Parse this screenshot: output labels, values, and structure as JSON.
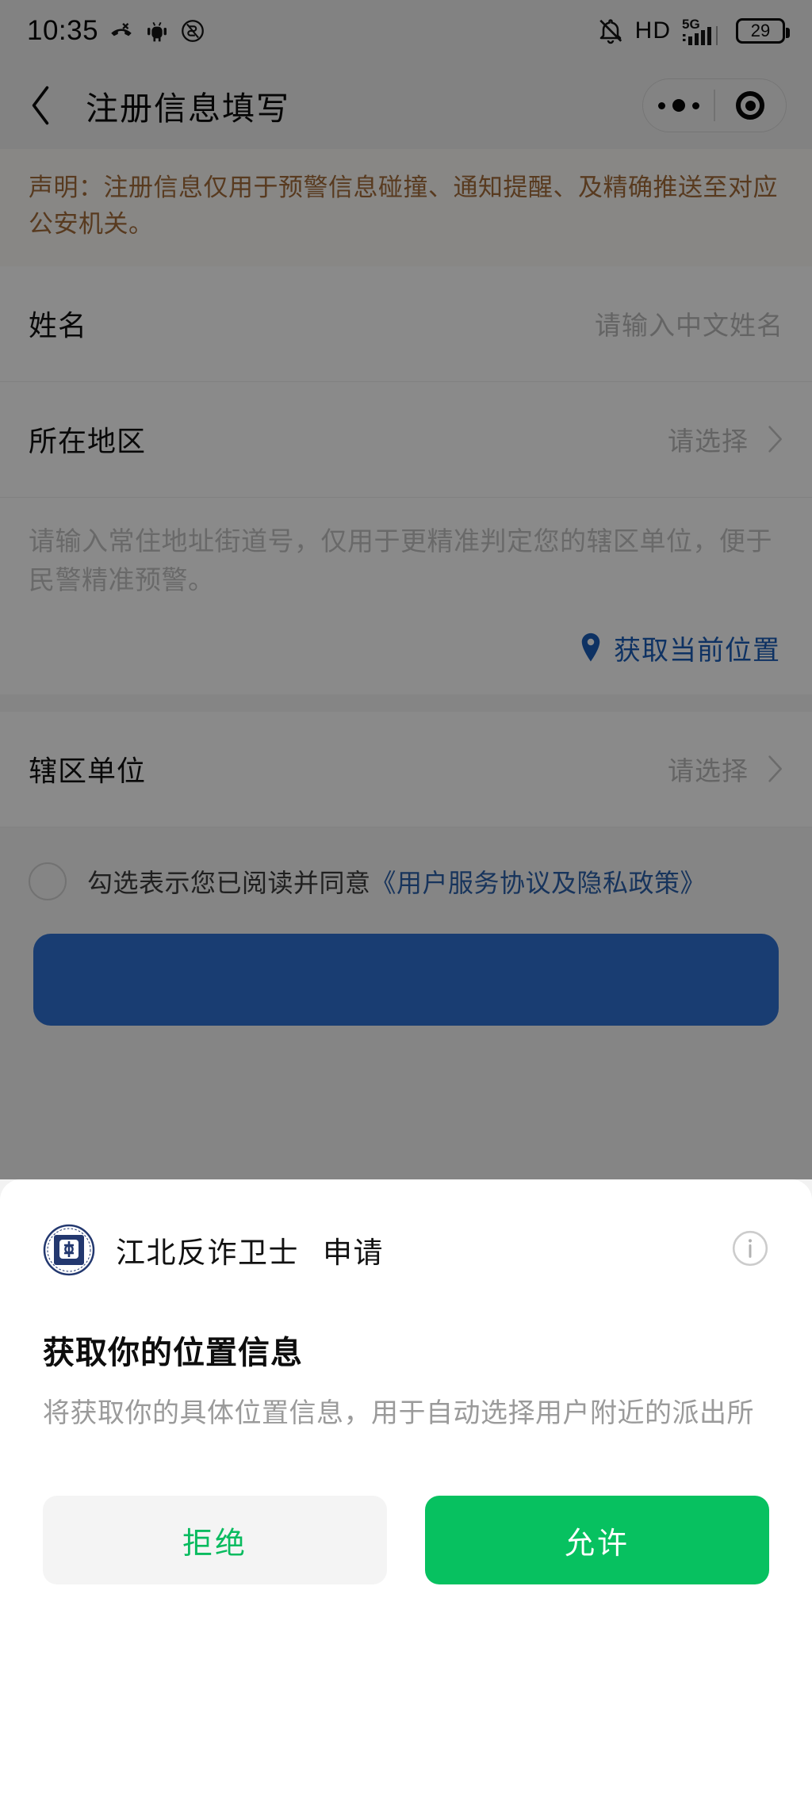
{
  "statusbar": {
    "time": "10:35",
    "icons_left": [
      "missed-call-icon",
      "android-debug-icon",
      "silent-mode-icon"
    ],
    "icons_right": [
      "bell-off-icon",
      "hd-icon",
      "signal-5g-icon",
      "battery-icon"
    ],
    "hd_label": "HD",
    "network_label": "5G",
    "battery_level": "29"
  },
  "navbar": {
    "back_icon": "chevron-left-icon",
    "title": "注册信息填写",
    "capsule": {
      "more_icon": "more-dots-icon",
      "close_icon": "target-circle-icon"
    }
  },
  "notice": {
    "text": "声明：注册信息仅用于预警信息碰撞、通知提醒、及精确推送至对应公安机关。",
    "color": "#a06a3a"
  },
  "form": {
    "rows": [
      {
        "label": "姓名",
        "value": "",
        "placeholder": "请输入中文姓名",
        "has_chevron": false
      },
      {
        "label": "所在地区",
        "value": "请选择",
        "placeholder": "请选择",
        "has_chevron": true
      }
    ],
    "address": {
      "placeholder": "请输入常住地址街道号，仅用于更精准判定您的辖区单位，便于民警精准预警。",
      "locate_label": "获取当前位置",
      "locate_icon": "location-pin-icon",
      "locate_color": "#1a5bb5"
    },
    "unit_row": {
      "label": "辖区单位",
      "value": "请选择",
      "has_chevron": true
    },
    "agreement": {
      "checkbox_icon": "checkbox-circle-unchecked",
      "checked": false,
      "prefix": "勾选表示您已阅读并同意",
      "link": "《用户服务协议及隐私政策》",
      "link_color": "#2b5fa8"
    }
  },
  "dialog": {
    "app_name": "江北反诈卫士",
    "action_word": "申请",
    "logo_icon": "police-badge-logo",
    "info_icon": "info-circle-icon",
    "title": "获取你的位置信息",
    "body": "将获取你的具体位置信息，用于自动选择用户附近的派出所",
    "deny_label": "拒绝",
    "allow_label": "允许",
    "allow_color": "#07c160",
    "deny_text_color": "#09bb5f"
  }
}
